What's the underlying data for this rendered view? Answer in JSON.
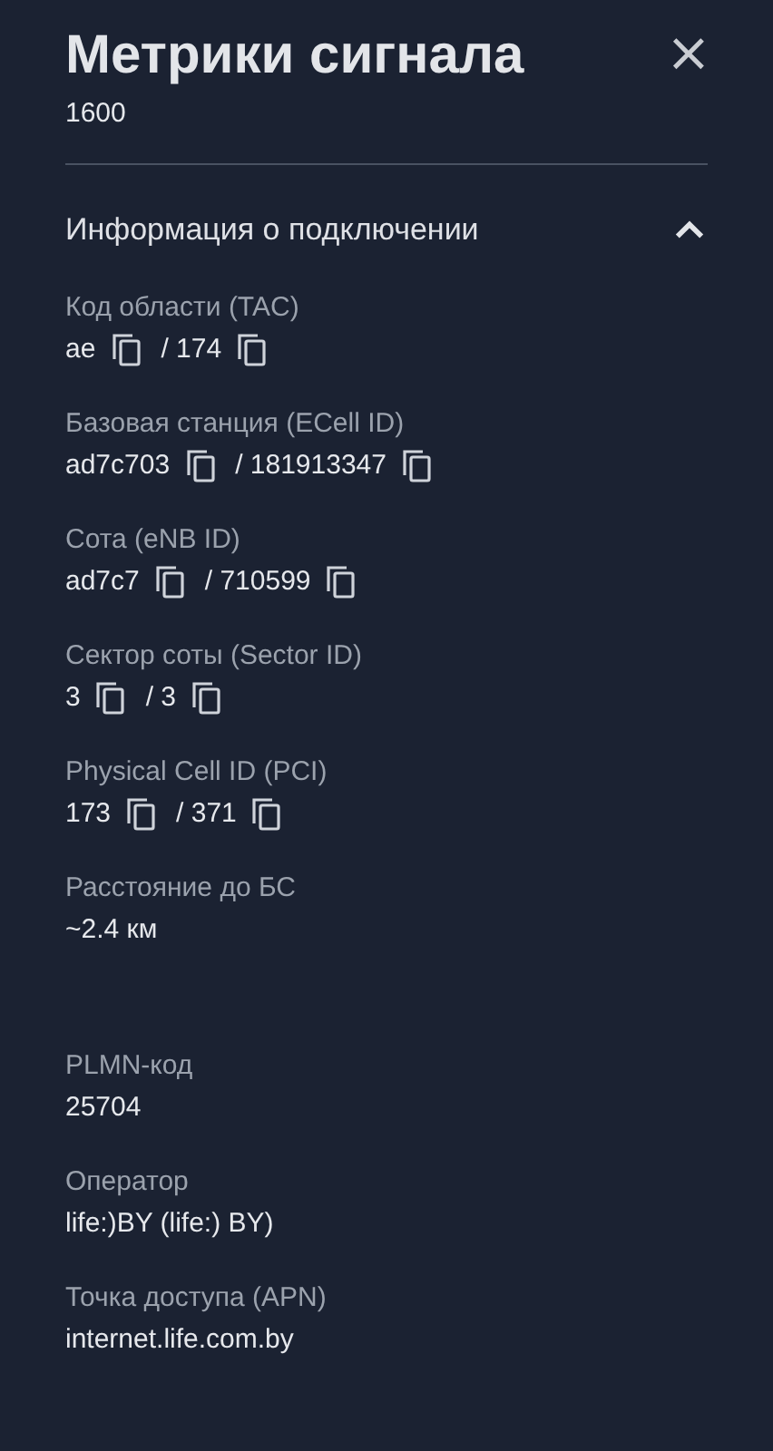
{
  "header": {
    "title": "Метрики сигнала",
    "subtitle": "1600",
    "close": "×"
  },
  "section": {
    "title": "Информация о подключении",
    "expanded": true
  },
  "fields": [
    {
      "kind": "ids",
      "label": "Код области (TAC)",
      "parts": [
        "ae",
        "/ 174"
      ]
    },
    {
      "kind": "ids",
      "label": "Базовая станция (ECell ID)",
      "parts": [
        "ad7c703",
        "/ 181913347"
      ]
    },
    {
      "kind": "ids",
      "label": "Сота (eNB ID)",
      "parts": [
        "ad7c7",
        "/ 710599"
      ]
    },
    {
      "kind": "ids",
      "label": "Сектор соты (Sector ID)",
      "parts": [
        "3",
        "/ 3"
      ]
    },
    {
      "kind": "ids",
      "label": "Physical Cell ID (PCI)",
      "parts": [
        "173",
        "/ 371"
      ]
    },
    {
      "kind": "text",
      "label": "Расстояние до БС",
      "value": "~2.4 км"
    }
  ],
  "network_fields": [
    {
      "kind": "text",
      "label": "PLMN-код",
      "value": "25704"
    },
    {
      "kind": "text",
      "label": "Оператор",
      "value": "life:)BY (life:) BY)"
    },
    {
      "kind": "text",
      "label": "Точка доступа (APN)",
      "value": "internet.life.com.by"
    }
  ]
}
